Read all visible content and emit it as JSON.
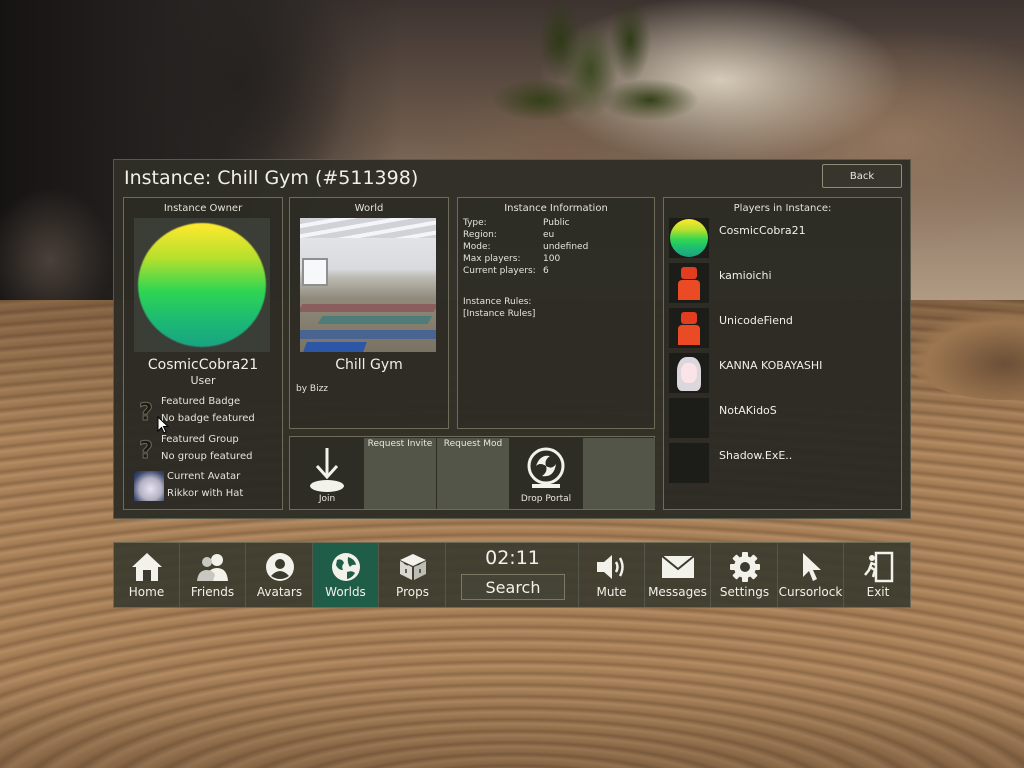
{
  "panel": {
    "title": "Instance: Chill Gym (#511398)",
    "back_label": "Back"
  },
  "owner": {
    "heading": "Instance Owner",
    "name": "CosmicCobra21",
    "role": "User",
    "badge_title": "Featured Badge",
    "badge_value": "No badge featured",
    "group_title": "Featured Group",
    "group_value": "No group featured",
    "avatar_title": "Current Avatar",
    "avatar_value": "Rikkor with Hat"
  },
  "world": {
    "heading": "World",
    "name": "Chill Gym",
    "author": "by Bizz"
  },
  "info": {
    "heading": "Instance Information",
    "rows": [
      {
        "key": "Type:",
        "value": "Public"
      },
      {
        "key": "Region:",
        "value": "eu"
      },
      {
        "key": "Mode:",
        "value": "undefined"
      },
      {
        "key": "Max players:",
        "value": "100"
      },
      {
        "key": "Current players:",
        "value": "6"
      }
    ],
    "rules_title": "Instance Rules:",
    "rules_value": "[Instance Rules]"
  },
  "actions": {
    "join": "Join",
    "request_invite": "Request Invite",
    "request_mod": "Request Mod",
    "drop_portal": "Drop Portal"
  },
  "players": {
    "heading": "Players in Instance:",
    "list": [
      "CosmicCobra21",
      "kamioichi",
      "UnicodeFiend",
      "KANNA KOBAYASHI",
      "NotAKidoS",
      "Shadow.ExE.."
    ]
  },
  "menu": {
    "items": [
      "Home",
      "Friends",
      "Avatars",
      "Worlds",
      "Props",
      "Mute",
      "Messages",
      "Settings",
      "Cursorlock",
      "Exit"
    ],
    "active": "Worlds",
    "clock": "02:11",
    "search_label": "Search"
  },
  "colors": {
    "panel_bg": "#2f2e26",
    "active_tab": "#1f5d48",
    "owner_avatar_top": "#ffe92e",
    "owner_avatar_bottom": "#1aa382"
  }
}
